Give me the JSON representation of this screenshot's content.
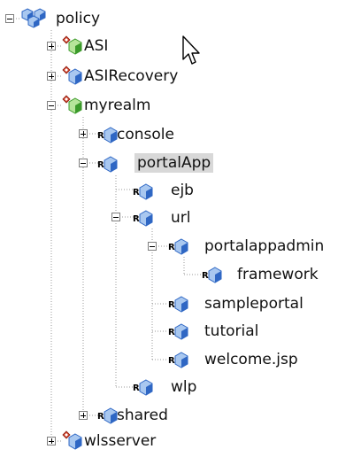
{
  "tree": {
    "nodes": [
      {
        "id": "policy",
        "label": "policy",
        "icon": "policy-root-icon",
        "toggle": "expanded",
        "selected": false
      },
      {
        "id": "asi",
        "label": "ASI",
        "icon": "realm-green-icon",
        "toggle": "collapsed",
        "selected": false
      },
      {
        "id": "asirecovery",
        "label": "ASIRecovery",
        "icon": "realm-blue-icon",
        "toggle": "collapsed",
        "selected": false
      },
      {
        "id": "myrealm",
        "label": "myrealm",
        "icon": "realm-green-icon",
        "toggle": "expanded",
        "selected": false
      },
      {
        "id": "console",
        "label": "console",
        "icon": "resource-icon",
        "toggle": "collapsed",
        "selected": false
      },
      {
        "id": "portalapp",
        "label": "portalApp",
        "icon": "resource-icon",
        "toggle": "expanded",
        "selected": true
      },
      {
        "id": "ejb",
        "label": "ejb",
        "icon": "resource-icon",
        "toggle": "none",
        "selected": false
      },
      {
        "id": "url",
        "label": "url",
        "icon": "resource-icon",
        "toggle": "expanded",
        "selected": false
      },
      {
        "id": "portalappadmin",
        "label": "portalappadmin",
        "icon": "resource-icon",
        "toggle": "expanded",
        "selected": false
      },
      {
        "id": "framework",
        "label": "framework",
        "icon": "resource-icon",
        "toggle": "none",
        "selected": false
      },
      {
        "id": "sampleportal",
        "label": "sampleportal",
        "icon": "resource-icon",
        "toggle": "none",
        "selected": false
      },
      {
        "id": "tutorial",
        "label": "tutorial",
        "icon": "resource-icon",
        "toggle": "none",
        "selected": false
      },
      {
        "id": "welcomejsp",
        "label": "welcome.jsp",
        "icon": "resource-icon",
        "toggle": "none",
        "selected": false
      },
      {
        "id": "wlp",
        "label": "wlp",
        "icon": "resource-icon",
        "toggle": "none",
        "selected": false
      },
      {
        "id": "shared",
        "label": "shared",
        "icon": "resource-icon",
        "toggle": "collapsed",
        "selected": false
      },
      {
        "id": "wlsserver",
        "label": "wlsserver",
        "icon": "realm-blue-icon",
        "toggle": "collapsed",
        "selected": false
      }
    ]
  },
  "resource_badge": "R",
  "colors": {
    "connector": "#9a9a9a",
    "cube_blue_light": "#a9c8f0",
    "cube_blue_dark": "#2f67c4",
    "cube_green_light": "#b6e59a",
    "cube_green_dark": "#3b9a2a",
    "realm_diamond": "#d2412a",
    "selection_bg": "#d8d8d8"
  }
}
